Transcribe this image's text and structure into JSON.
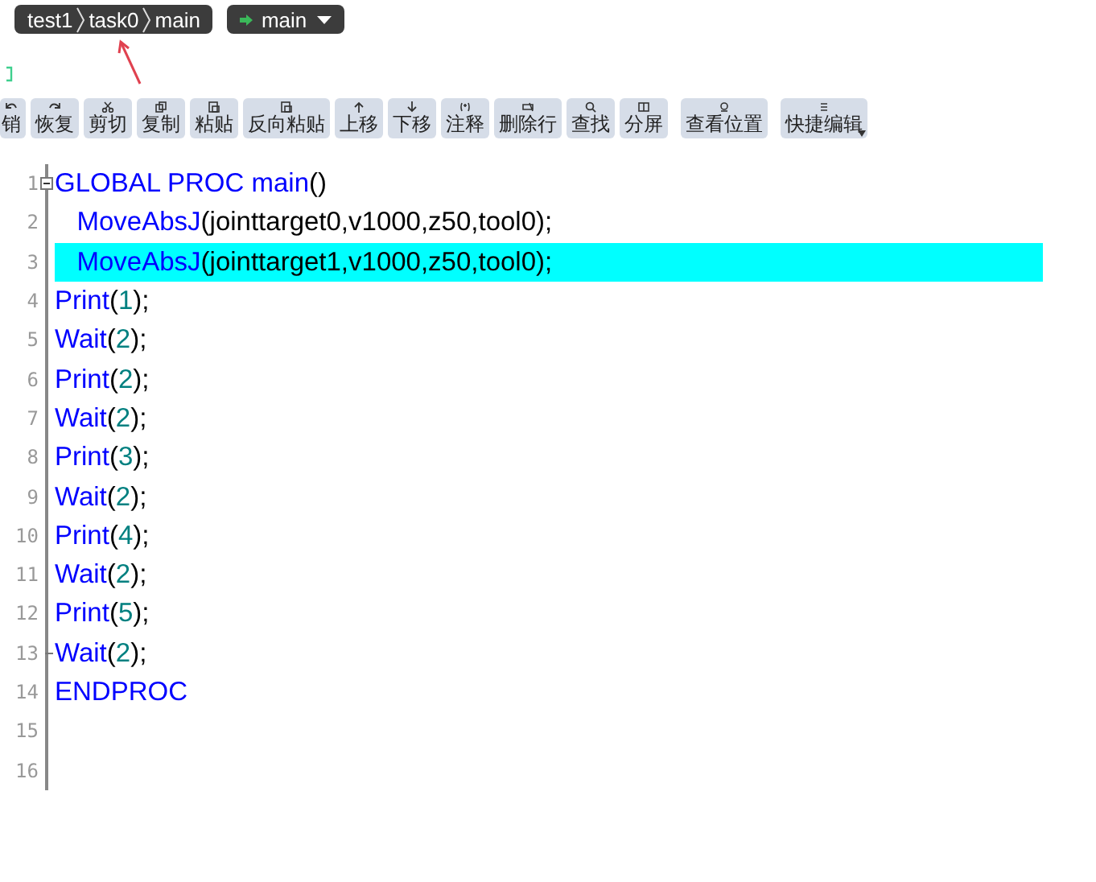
{
  "breadcrumb": [
    "test1",
    "task0",
    "main"
  ],
  "routine_selector": {
    "label": "main"
  },
  "toolbar": [
    {
      "label": "销"
    },
    {
      "label": "恢复"
    },
    {
      "label": "剪切"
    },
    {
      "label": "复制"
    },
    {
      "label": "粘贴"
    },
    {
      "label": "反向粘贴"
    },
    {
      "label": "上移"
    },
    {
      "label": "下移"
    },
    {
      "label": "注释"
    },
    {
      "label": "删除行"
    },
    {
      "label": "查找"
    },
    {
      "label": "分屏"
    },
    {
      "label": "查看位置"
    },
    {
      "label": "快捷编辑",
      "dropdown": true
    }
  ],
  "editor": {
    "lines": [
      {
        "number": "1",
        "kind": "fold_start",
        "highlighted": false,
        "tokens": [
          {
            "text": "GLOBAL PROC main",
            "kind": "keyword"
          },
          {
            "text": "()",
            "kind": "punct"
          }
        ]
      },
      {
        "number": "2",
        "kind": "plain",
        "highlighted": false,
        "tokens": [
          {
            "text": "   MoveAbsJ",
            "kind": "keyword"
          },
          {
            "text": "(jointtarget0,v1000,z50,tool0);",
            "kind": "punct"
          }
        ]
      },
      {
        "number": "3",
        "kind": "plain",
        "highlighted": true,
        "tokens": [
          {
            "text": "   MoveAbsJ",
            "kind": "keyword"
          },
          {
            "text": "(jointtarget1,v1000,z50,tool0);",
            "kind": "punct"
          }
        ]
      },
      {
        "number": "4",
        "kind": "plain",
        "highlighted": false,
        "tokens": [
          {
            "text": "Print",
            "kind": "keyword"
          },
          {
            "text": "(",
            "kind": "punct"
          },
          {
            "text": "1",
            "kind": "number"
          },
          {
            "text": ");",
            "kind": "punct"
          }
        ]
      },
      {
        "number": "5",
        "kind": "plain",
        "highlighted": false,
        "tokens": [
          {
            "text": "Wait",
            "kind": "keyword"
          },
          {
            "text": "(",
            "kind": "punct"
          },
          {
            "text": "2",
            "kind": "number"
          },
          {
            "text": ");",
            "kind": "punct"
          }
        ]
      },
      {
        "number": "6",
        "kind": "plain",
        "highlighted": false,
        "tokens": [
          {
            "text": "Print",
            "kind": "keyword"
          },
          {
            "text": "(",
            "kind": "punct"
          },
          {
            "text": "2",
            "kind": "number"
          },
          {
            "text": ");",
            "kind": "punct"
          }
        ]
      },
      {
        "number": "7",
        "kind": "plain",
        "highlighted": false,
        "tokens": [
          {
            "text": "Wait",
            "kind": "keyword"
          },
          {
            "text": "(",
            "kind": "punct"
          },
          {
            "text": "2",
            "kind": "number"
          },
          {
            "text": ");",
            "kind": "punct"
          }
        ]
      },
      {
        "number": "8",
        "kind": "plain",
        "highlighted": false,
        "tokens": [
          {
            "text": "Print",
            "kind": "keyword"
          },
          {
            "text": "(",
            "kind": "punct"
          },
          {
            "text": "3",
            "kind": "number"
          },
          {
            "text": ");",
            "kind": "punct"
          }
        ]
      },
      {
        "number": "9",
        "kind": "plain",
        "highlighted": false,
        "tokens": [
          {
            "text": "Wait",
            "kind": "keyword"
          },
          {
            "text": "(",
            "kind": "punct"
          },
          {
            "text": "2",
            "kind": "number"
          },
          {
            "text": ");",
            "kind": "punct"
          }
        ]
      },
      {
        "number": "10",
        "kind": "plain",
        "highlighted": false,
        "tokens": [
          {
            "text": "Print",
            "kind": "keyword"
          },
          {
            "text": "(",
            "kind": "punct"
          },
          {
            "text": "4",
            "kind": "number"
          },
          {
            "text": ");",
            "kind": "punct"
          }
        ]
      },
      {
        "number": "11",
        "kind": "plain",
        "highlighted": false,
        "tokens": [
          {
            "text": "Wait",
            "kind": "keyword"
          },
          {
            "text": "(",
            "kind": "punct"
          },
          {
            "text": "2",
            "kind": "number"
          },
          {
            "text": ");",
            "kind": "punct"
          }
        ]
      },
      {
        "number": "12",
        "kind": "plain",
        "highlighted": false,
        "tokens": [
          {
            "text": "Print",
            "kind": "keyword"
          },
          {
            "text": "(",
            "kind": "punct"
          },
          {
            "text": "5",
            "kind": "number"
          },
          {
            "text": ");",
            "kind": "punct"
          }
        ]
      },
      {
        "number": "13",
        "kind": "fold_end",
        "highlighted": false,
        "tokens": [
          {
            "text": "Wait",
            "kind": "keyword"
          },
          {
            "text": "(",
            "kind": "punct"
          },
          {
            "text": "2",
            "kind": "number"
          },
          {
            "text": ");",
            "kind": "punct"
          }
        ]
      },
      {
        "number": "14",
        "kind": "plain",
        "highlighted": false,
        "tokens": [
          {
            "text": "ENDPROC",
            "kind": "keyword"
          }
        ]
      },
      {
        "number": "15",
        "kind": "plain",
        "highlighted": false
      },
      {
        "number": "16",
        "kind": "plain",
        "highlighted": false
      }
    ]
  }
}
